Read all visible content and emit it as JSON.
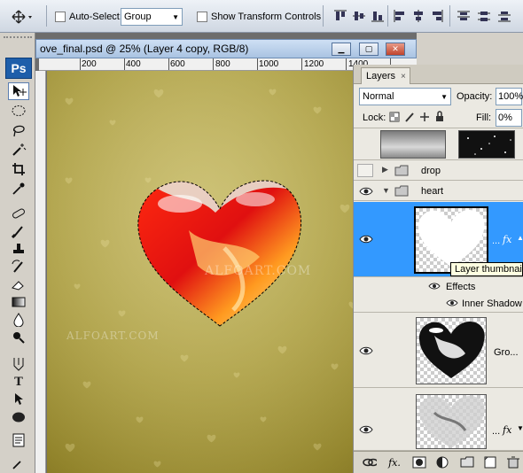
{
  "options_bar": {
    "auto_select_label": "Auto-Select:",
    "auto_select_value": "Group",
    "show_transform_label": "Show Transform Controls"
  },
  "toolbox": {
    "logo": "Ps",
    "tools": [
      "move-tool",
      "marquee-tool",
      "lasso-tool",
      "magic-wand-tool",
      "crop-tool",
      "eyedropper-tool",
      "healing-brush-tool",
      "brush-tool",
      "clone-stamp-tool",
      "history-brush-tool",
      "eraser-tool",
      "gradient-tool",
      "blur-tool",
      "dodge-tool",
      "pen-tool",
      "type-tool",
      "path-selection-tool",
      "ellipse-tool",
      "notes-tool"
    ]
  },
  "document": {
    "title": "ove_final.psd @ 25% (Layer 4 copy, RGB/8)",
    "ruler_labels": [
      "200",
      "400",
      "600",
      "800",
      "1000",
      "1200",
      "1400"
    ],
    "watermark_center": "ALFOART.COM",
    "watermark_left": "ALFOART.COM"
  },
  "layers_panel": {
    "tab_label": "Layers",
    "tab_close": "×",
    "blend_mode": "Normal",
    "opacity_label": "Opacity:",
    "opacity_value": "100%",
    "lock_label": "Lock:",
    "fill_label": "Fill:",
    "fill_value": "0%",
    "groups": [
      {
        "name": "drop",
        "visible": false,
        "expanded": false
      },
      {
        "name": "heart",
        "visible": true,
        "expanded": true
      }
    ],
    "selected_layer": {
      "fx": "fx",
      "ellipsis": "..."
    },
    "effects_label": "Effects",
    "inner_shadow_label": "Inner Shadow",
    "layer_gro_label": "Gro...",
    "last_layer": {
      "fx": "fx",
      "ellipsis": "..."
    },
    "tooltip": "Layer thumbnail"
  },
  "colors": {
    "selection_blue": "#3399ff",
    "canvas_gold": "#a89a3f"
  }
}
